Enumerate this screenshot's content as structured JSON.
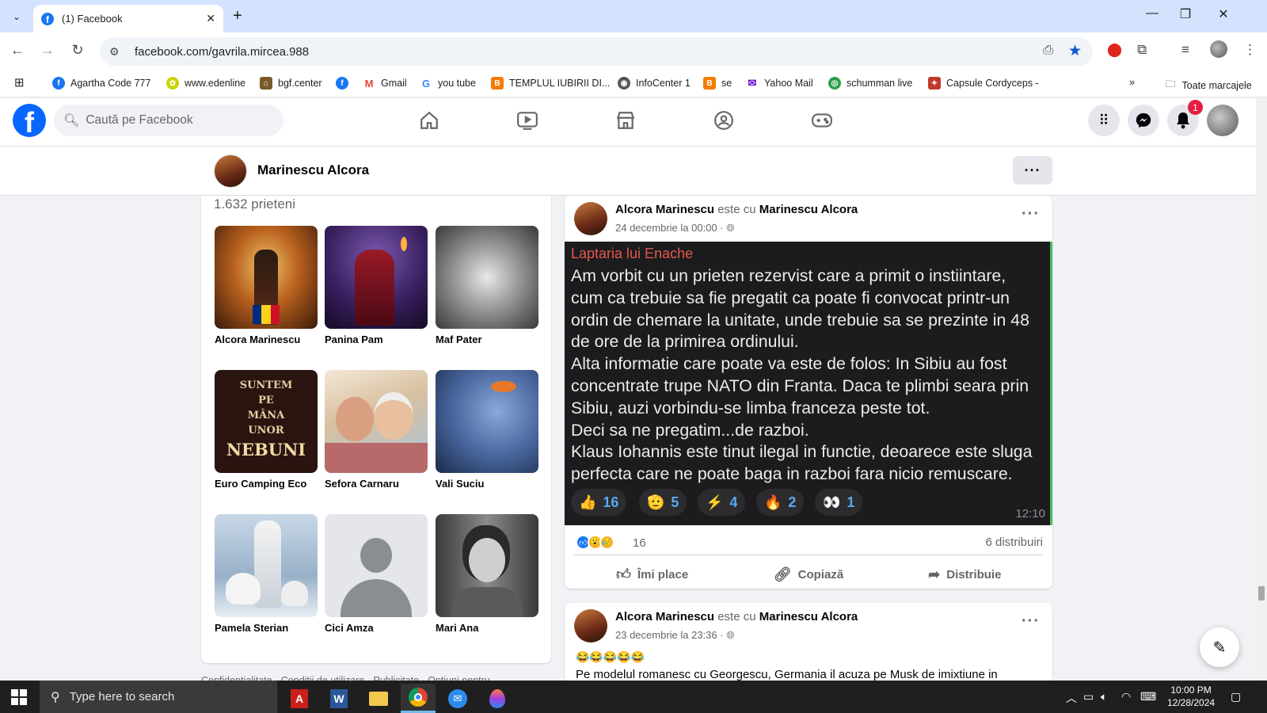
{
  "browser": {
    "tab_title": "(1) Facebook",
    "url": "facebook.com/gavrila.mircea.988",
    "bookmarks": [
      {
        "label": "Agartha Code 777",
        "color": "#1877f2",
        "glyph": "f"
      },
      {
        "label": "www.edenline",
        "color": "#c9d400",
        "glyph": "✿"
      },
      {
        "label": "bgf.center",
        "color": "#7a5a2a",
        "glyph": "⌂"
      },
      {
        "label": "",
        "color": "#1877f2",
        "glyph": "f"
      },
      {
        "label": "Gmail",
        "color": "#ea4335",
        "glyph": "M"
      },
      {
        "label": "you tube",
        "color": "#4285f4",
        "glyph": "G"
      },
      {
        "label": "TEMPLUL IUBIRII DI...",
        "color": "#f57c00",
        "glyph": "B"
      },
      {
        "label": "InfoCenter 1",
        "color": "#555555",
        "glyph": "◉"
      },
      {
        "label": "se",
        "color": "#f57c00",
        "glyph": "B"
      },
      {
        "label": "Yahoo Mail",
        "color": "#6001d2",
        "glyph": "✉"
      },
      {
        "label": "schumman live",
        "color": "#2e9e4a",
        "glyph": "◎"
      },
      {
        "label": "Capsule Cordyceps -",
        "color": "#c0392b",
        "glyph": "✦"
      }
    ],
    "all_bookmarks_label": "Toate marcajele"
  },
  "facebook": {
    "search_placeholder": "Caută pe Facebook",
    "notification_count": "1",
    "profile_name": "Marinescu Alcora"
  },
  "friends": {
    "count_label": "1.632 prieteni",
    "items": [
      {
        "name": "Alcora Marinescu"
      },
      {
        "name": "Panina Pam"
      },
      {
        "name": "Maf Pater"
      },
      {
        "name": "Euro Camping Eco"
      },
      {
        "name": "Sefora Carnaru"
      },
      {
        "name": "Vali Suciu"
      },
      {
        "name": "Pamela Sterian"
      },
      {
        "name": "Cici Amza"
      },
      {
        "name": "Mari Ana"
      }
    ],
    "book_text": [
      "SUNTEM",
      "PE",
      "MÂNA",
      "UNOR",
      "NEBUNI"
    ],
    "footer_links": "Confidențialitate · Condiții de utilizare · Publicitate · Opțiuni pentru"
  },
  "post1": {
    "author": "Alcora Marinescu",
    "with_word": "este cu",
    "tagged": "Marinescu Alcora",
    "date": "24 decembrie la 00:00 ·",
    "image": {
      "channel": "Laptaria lui Enache",
      "text": "Am vorbit cu un prieten rezervist care a primit o instiintare, cum ca trebuie sa fie pregatit ca poate fi convocat printr-un ordin de chemare la unitate, unde trebuie sa se prezinte in 48 de ore de la primirea ordinului.\nAlta informatie care poate va este de folos: In Sibiu au fost concentrate trupe NATO din Franta. Daca te plimbi seara prin Sibiu, auzi vorbindu-se limba franceza peste tot.\nDeci sa ne pregatim...de razboi.\nKlaus Iohannis este tinut ilegal in functie, deoarece este sluga perfecta care ne poate baga in razboi fara nicio remuscare.",
      "reactions": [
        {
          "emoji": "👍",
          "count": "16"
        },
        {
          "emoji": "🫡",
          "count": "5"
        },
        {
          "emoji": "⚡",
          "count": "4"
        },
        {
          "emoji": "🔥",
          "count": "2"
        },
        {
          "emoji": "👀",
          "count": "1"
        }
      ],
      "time": "12:10"
    },
    "reaction_count": "16",
    "shares": "6 distribuiri",
    "actions": {
      "like": "Îmi place",
      "copy": "Copiază",
      "share": "Distribuie"
    }
  },
  "post2": {
    "author": "Alcora Marinescu",
    "with_word": "este cu",
    "tagged": "Marinescu Alcora",
    "date": "23 decembrie la 23:36 ·",
    "emojis": "😂😂😂😂😂",
    "text": "Pe modelul romanesc cu Georgescu, Germania il acuza pe Musk de imixtiune in"
  },
  "taskbar": {
    "search_placeholder": "Type here to search",
    "time": "10:00 PM",
    "date": "12/28/2024"
  }
}
